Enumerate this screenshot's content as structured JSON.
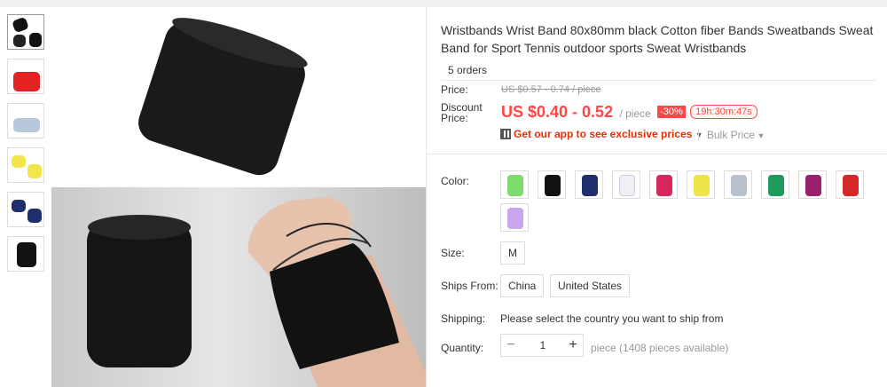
{
  "product": {
    "title": "Wristbands Wrist Band 80x80mm black Cotton fiber Bands Sweatbands Sweat Band for Sport Tennis outdoor sports Sweat Wristbands",
    "orders": "5 orders"
  },
  "thumbnails": [
    "black",
    "red",
    "light blue",
    "yellow",
    "navy",
    "black"
  ],
  "price": {
    "label": "Price:",
    "original": "US $0.57 - 0.74 / piece",
    "discount_label_1": "Discount",
    "discount_label_2": "Price:",
    "current": "US $0.40 - 0.52",
    "unit": "/ piece",
    "discount_badge": "-30%",
    "timer": "19h:30m:47s",
    "app_promo": "Get our app to see exclusive prices",
    "bulk_price": "Bulk Price"
  },
  "color": {
    "label": "Color:",
    "swatches": [
      "#7ddc6b",
      "#111111",
      "#1f2f6b",
      "#eef0f6",
      "#d6285c",
      "#f0e24a",
      "#b9c2cc",
      "#1e9a5b",
      "#9a1f6e",
      "#d62828",
      "#c9a6ee"
    ]
  },
  "size": {
    "label": "Size:",
    "value": "M"
  },
  "ships_from": {
    "label": "Ships From:",
    "options": [
      "China",
      "United States"
    ]
  },
  "shipping": {
    "label": "Shipping:",
    "text": "Please select the country you want to ship from"
  },
  "quantity": {
    "label": "Quantity:",
    "value": "1",
    "minus": "−",
    "plus": "+",
    "available": "piece (1408 pieces available)"
  },
  "colors": {
    "accent": "#ff4747",
    "promo_red": "#e62e04",
    "border": "#dddddd"
  }
}
